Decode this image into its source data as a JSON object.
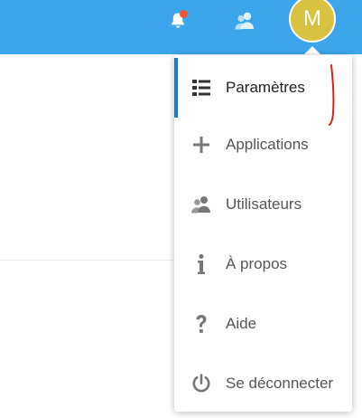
{
  "colors": {
    "topbar": "#3ba6ec",
    "avatar": "#d9c242",
    "notification_dot": "#f2542d",
    "active_indicator": "#1a7ccc",
    "annotation": "#e0201b"
  },
  "header": {
    "bell_icon": "bell-icon",
    "contacts_icon": "contacts-icon",
    "avatar_letter": "M"
  },
  "menu": {
    "items": [
      {
        "label": "Paramètres",
        "icon": "settings-list-icon",
        "active": true
      },
      {
        "label": "Applications",
        "icon": "plus-icon",
        "active": false
      },
      {
        "label": "Utilisateurs",
        "icon": "users-icon",
        "active": false
      },
      {
        "label": "À propos",
        "icon": "info-icon",
        "active": false
      },
      {
        "label": "Aide",
        "icon": "question-icon",
        "active": false
      },
      {
        "label": "Se déconnecter",
        "icon": "power-icon",
        "active": false
      }
    ]
  }
}
